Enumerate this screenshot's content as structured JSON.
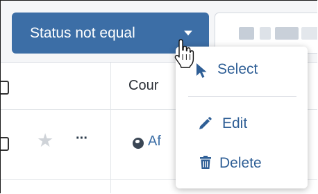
{
  "filter_bar": {
    "active_filter_label": "Status not equal",
    "active_filter_icon": "chevron-down-icon"
  },
  "table": {
    "header": {
      "visible_column_label": "Cour"
    },
    "row": {
      "cell_text": "Af",
      "row_icons": [
        "star-icon",
        "more-icon",
        "globe-icon"
      ]
    }
  },
  "context_menu": {
    "items": [
      {
        "label": "Select",
        "icon": "pointer-icon"
      },
      {
        "label": "Edit",
        "icon": "pencil-icon"
      },
      {
        "label": "Delete",
        "icon": "trash-icon"
      }
    ]
  },
  "colors": {
    "accent": "#3c6ea6",
    "menu_text": "#2f5f96",
    "border": "#e3e6ea"
  }
}
